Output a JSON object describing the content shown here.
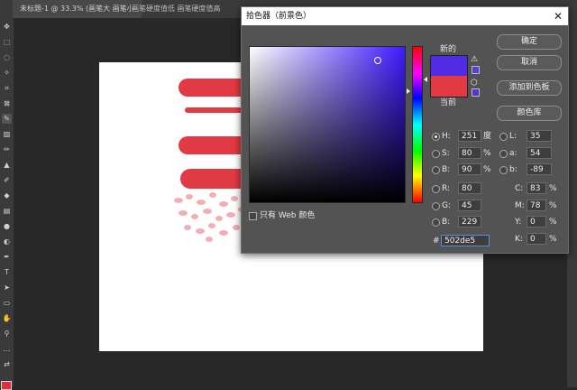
{
  "workspace": {
    "doc_tab": "未标题-1 @ 33.3% (画笔大 画笔小",
    "doc_tab_rest": "画笔硬度值低  画笔硬度值高",
    "brand": {
      "stroke_color": "#e23a44"
    }
  },
  "dialog": {
    "title": "拾色器（前景色）",
    "new_label": "新的",
    "current_label": "当前",
    "new_color": "#502de5",
    "current_color": "#e23a44",
    "buttons": {
      "ok": "确定",
      "cancel": "取消",
      "add_to_swatches": "添加到色板",
      "color_libraries": "颜色库"
    },
    "web_only_label": "只有 Web 颜色",
    "hsb": {
      "h_label": "H:",
      "h_value": "251",
      "h_unit": "度",
      "s_label": "S:",
      "s_value": "80",
      "s_unit": "%",
      "b_label": "B:",
      "b_value": "90",
      "b_unit": "%"
    },
    "rgb": {
      "r_label": "R:",
      "r_value": "80",
      "g_label": "G:",
      "g_value": "45",
      "b_label": "B:",
      "b_value": "229"
    },
    "lab": {
      "l_label": "L:",
      "l_value": "35",
      "a_label": "a:",
      "a_value": "54",
      "b_label": "b:",
      "b_value": "-89"
    },
    "cmyk": {
      "c_label": "C:",
      "c_value": "83",
      "c_unit": "%",
      "m_label": "M:",
      "m_value": "78",
      "m_unit": "%",
      "y_label": "Y:",
      "y_value": "0",
      "y_unit": "%",
      "k_label": "K:",
      "k_value": "0",
      "k_unit": "%"
    },
    "hex_label": "#",
    "hex_value": "502de5"
  }
}
